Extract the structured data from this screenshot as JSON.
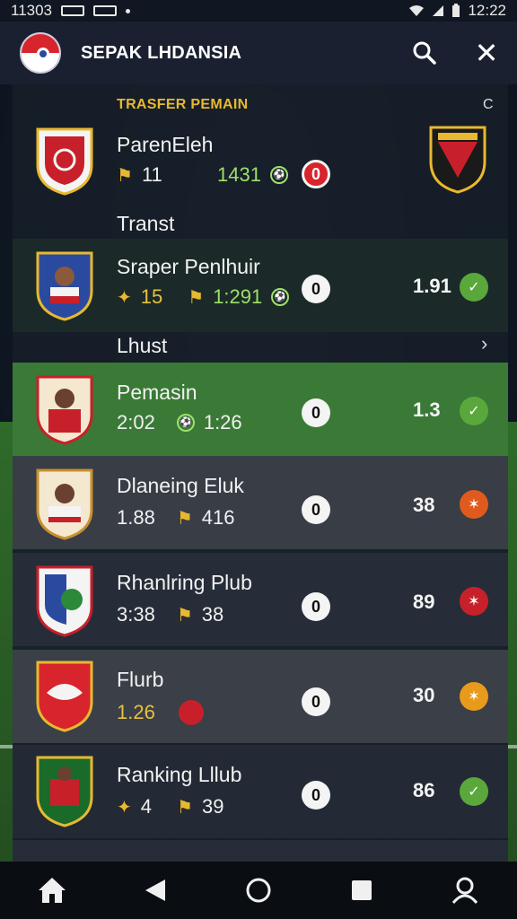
{
  "status_bar": {
    "time_left": "11303",
    "time_right": "12:22"
  },
  "header": {
    "title": "SEPAK LHDANSIA",
    "search_icon": "search-icon",
    "close_icon": "close-icon",
    "close_glyph": "✕"
  },
  "panel": {
    "section_label": "TRASFER PEMAIN",
    "top_right_icon": "C",
    "group_1_label": "Transt",
    "group_2_label": "Lhust",
    "group_2_chevron": "›"
  },
  "rows": [
    {
      "name": "ParenEleh",
      "meta_1": "11",
      "meta_2": "1431",
      "circle": "0",
      "score": "",
      "circle_style": "red",
      "status": "",
      "colors": {
        "badge": "#c8202a"
      }
    },
    {
      "name": "Sraper Penlhuir",
      "meta_1": "15",
      "meta_2": "1:291",
      "circle": "0",
      "score": "1.91",
      "status": "green",
      "colors": {
        "badge": "#2a4aa0"
      }
    },
    {
      "name": "Pemasin",
      "meta_1": "2:02",
      "meta_2": "1:26",
      "circle": "0",
      "score": "1.3",
      "status": "green",
      "colors": {
        "badge": "#c8202a"
      }
    },
    {
      "name": "Dlaneing Eluk",
      "meta_1": "1.88",
      "meta_2": "416",
      "circle": "0",
      "score": "38",
      "status": "orange",
      "colors": {
        "badge": "#f4e8d0"
      }
    },
    {
      "name": "Rhanlring Plub",
      "meta_1": "3:38",
      "meta_2": "38",
      "circle": "0",
      "score": "89",
      "status": "red",
      "colors": {
        "badge": "#2a8a3a"
      }
    },
    {
      "name": "Flurb",
      "meta_1": "1.26",
      "meta_2": "",
      "circle": "0",
      "score": "30",
      "status": "amber",
      "colors": {
        "badge": "#d8242c"
      }
    },
    {
      "name": "Ranking Lllub",
      "meta_1": "4",
      "meta_2": "39",
      "circle": "0",
      "score": "86",
      "status": "green",
      "colors": {
        "badge": "#1a6a2a"
      }
    }
  ],
  "nav": {
    "items": [
      "home-icon",
      "back-icon",
      "home-circle-icon",
      "recents-icon",
      "profile-icon"
    ]
  },
  "colors": {
    "accent_gold": "#e8b830",
    "header_bg": "#1a2030",
    "highlight_row": "#3a7a36"
  }
}
